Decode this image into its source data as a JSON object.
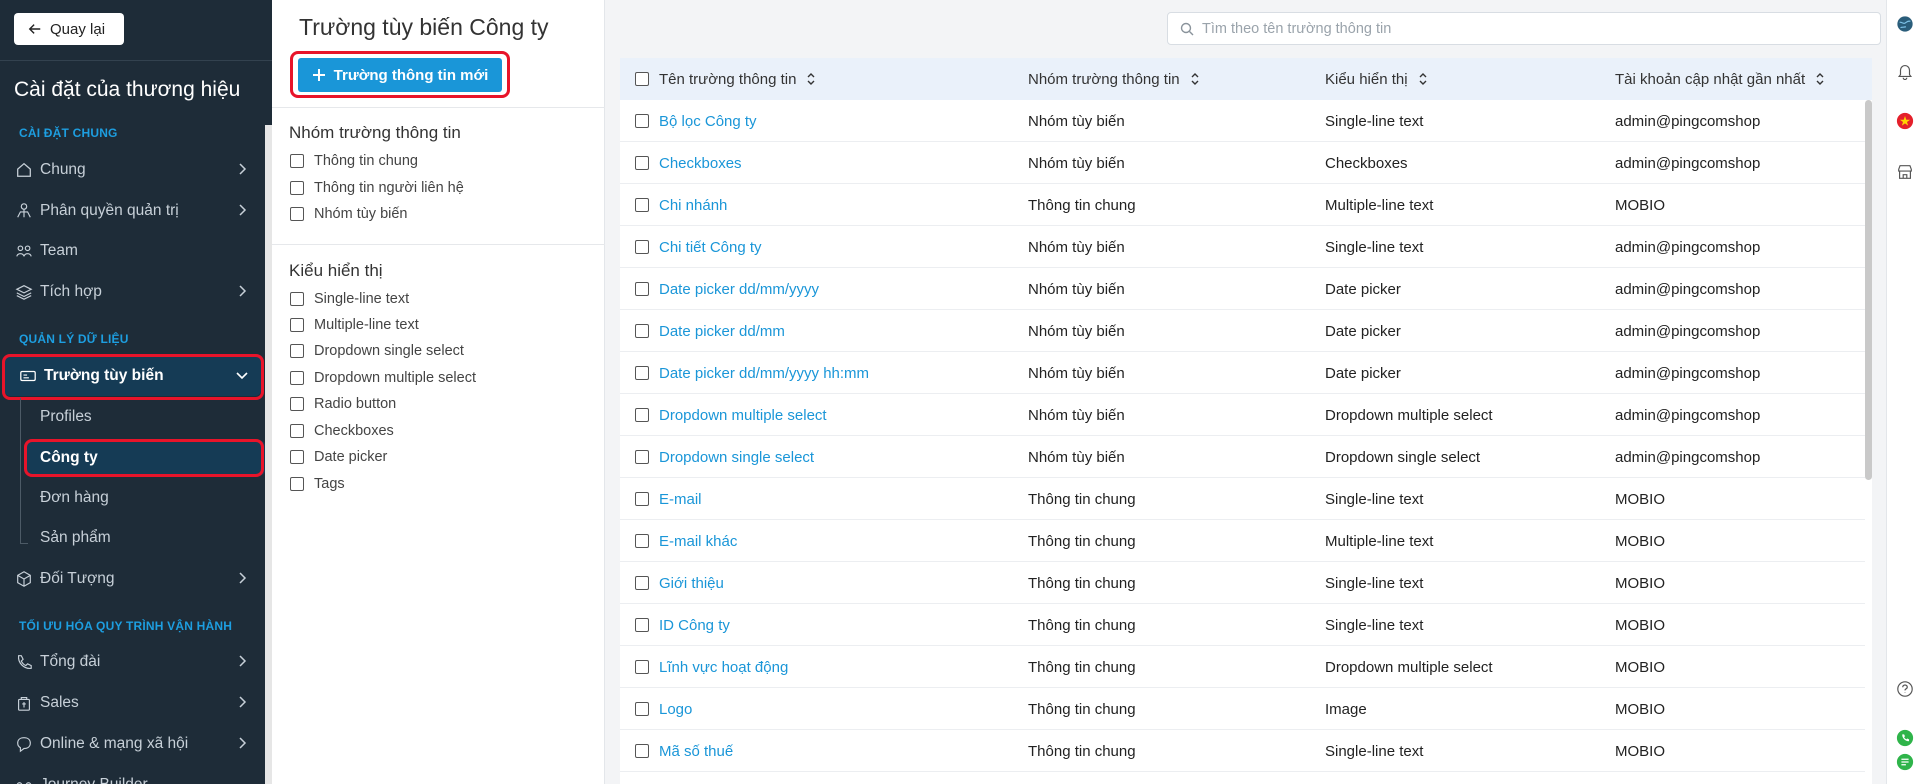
{
  "sidebar": {
    "back_label": "Quay lại",
    "brand_title": "Cài đặt của thương hiệu",
    "sections": {
      "general": "CÀI ĐẶT CHUNG",
      "data": "QUẢN LÝ DỮ LIỆU",
      "optimize": "TỐI ƯU HÓA QUY TRÌNH VẬN HÀNH"
    },
    "items": {
      "chung": "Chung",
      "phanquyen": "Phân quyền quản trị",
      "team": "Team",
      "tichhop": "Tích hợp",
      "truong": "Trường tùy biến",
      "profiles": "Profiles",
      "congty": "Công ty",
      "donhang": "Đơn hàng",
      "sanpham": "Sản phẩm",
      "doituong": "Đối Tượng",
      "tongdai": "Tổng đài",
      "sales": "Sales",
      "online": "Online & mạng xã hội",
      "journey": "Journey Builder"
    }
  },
  "filter": {
    "page_title": "Trường tùy biến Công ty",
    "new_button": "Trường thông tin mới",
    "group_title": "Nhóm trường thông tin",
    "groups": [
      "Thông tin chung",
      "Thông tin người liên hệ",
      "Nhóm tùy biến"
    ],
    "display_title": "Kiểu hiển thị",
    "display_types": [
      "Single-line text",
      "Multiple-line text",
      "Dropdown single select",
      "Dropdown multiple select",
      "Radio button",
      "Checkboxes",
      "Date picker",
      "Tags"
    ]
  },
  "search": {
    "placeholder": "Tìm theo tên trường thông tin"
  },
  "table": {
    "headers": {
      "name": "Tên trường thông tin",
      "group": "Nhóm trường thông tin",
      "type": "Kiểu hiển thị",
      "account": "Tài khoản cập nhật gần nhất"
    },
    "rows": [
      {
        "name": "Bộ lọc Công ty",
        "group": "Nhóm tùy biến",
        "type": "Single-line text",
        "account": "admin@pingcomshop"
      },
      {
        "name": "Checkboxes",
        "group": "Nhóm tùy biến",
        "type": "Checkboxes",
        "account": "admin@pingcomshop"
      },
      {
        "name": "Chi nhánh",
        "group": "Thông tin chung",
        "type": "Multiple-line text",
        "account": "MOBIO"
      },
      {
        "name": "Chi tiết Công ty",
        "group": "Nhóm tùy biến",
        "type": "Single-line text",
        "account": "admin@pingcomshop"
      },
      {
        "name": "Date picker dd/mm/yyyy",
        "group": "Nhóm tùy biến",
        "type": "Date picker",
        "account": "admin@pingcomshop"
      },
      {
        "name": "Date picker dd/mm",
        "group": "Nhóm tùy biến",
        "type": "Date picker",
        "account": "admin@pingcomshop"
      },
      {
        "name": "Date picker dd/mm/yyyy hh:mm",
        "group": "Nhóm tùy biến",
        "type": "Date picker",
        "account": "admin@pingcomshop"
      },
      {
        "name": "Dropdown multiple select",
        "group": "Nhóm tùy biến",
        "type": "Dropdown multiple select",
        "account": "admin@pingcomshop"
      },
      {
        "name": "Dropdown single select",
        "group": "Nhóm tùy biến",
        "type": "Dropdown single select",
        "account": "admin@pingcomshop"
      },
      {
        "name": "E-mail",
        "group": "Thông tin chung",
        "type": "Single-line text",
        "account": "MOBIO"
      },
      {
        "name": "E-mail khác",
        "group": "Thông tin chung",
        "type": "Multiple-line text",
        "account": "MOBIO"
      },
      {
        "name": "Giới thiệu",
        "group": "Thông tin chung",
        "type": "Single-line text",
        "account": "MOBIO"
      },
      {
        "name": "ID Công ty",
        "group": "Thông tin chung",
        "type": "Single-line text",
        "account": "MOBIO"
      },
      {
        "name": "Lĩnh vực hoạt động",
        "group": "Thông tin chung",
        "type": "Dropdown multiple select",
        "account": "MOBIO"
      },
      {
        "name": "Logo",
        "group": "Thông tin chung",
        "type": "Image",
        "account": "MOBIO"
      },
      {
        "name": "Mã số thuế",
        "group": "Thông tin chung",
        "type": "Single-line text",
        "account": "MOBIO"
      }
    ]
  },
  "colors": {
    "sidebar_bg": "#1e2c38",
    "accent": "#1a96d8",
    "active_bg": "#153b55",
    "highlight": "#e8142a"
  }
}
